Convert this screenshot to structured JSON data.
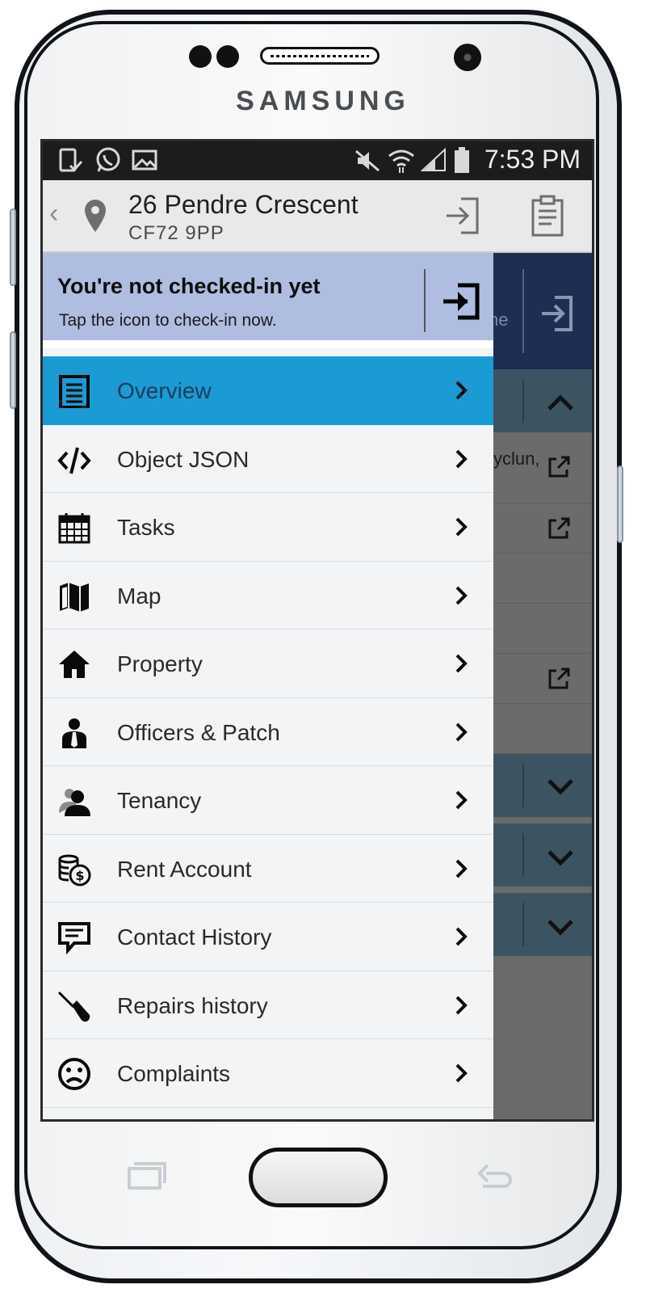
{
  "device": {
    "brand": "SAMSUNG"
  },
  "statusbar": {
    "time": "7:53 PM"
  },
  "appbar": {
    "title": "26 Pendre Crescent",
    "subtitle": "CF72 9PP"
  },
  "checkin_banner": {
    "title": "You're not checked-in yet",
    "subtitle": "Tap the icon to check-in now."
  },
  "background_snippets": {
    "navy_text": "ne",
    "row_text": "yclun,"
  },
  "menu": {
    "items": [
      {
        "label": "Overview",
        "icon": "document-icon",
        "active": true
      },
      {
        "label": "Object JSON",
        "icon": "code-icon"
      },
      {
        "label": "Tasks",
        "icon": "calendar-icon"
      },
      {
        "label": "Map",
        "icon": "map-icon"
      },
      {
        "label": "Property",
        "icon": "home-icon"
      },
      {
        "label": "Officers & Patch",
        "icon": "officer-icon"
      },
      {
        "label": "Tenancy",
        "icon": "tenants-icon"
      },
      {
        "label": "Rent Account",
        "icon": "coins-icon"
      },
      {
        "label": "Contact History",
        "icon": "chat-icon"
      },
      {
        "label": "Repairs history",
        "icon": "screwdriver-icon"
      },
      {
        "label": "Complaints",
        "icon": "sad-face-icon"
      }
    ]
  },
  "colors": {
    "active_item": "#1a9bd4",
    "banner": "#aebde0",
    "navy": "#1e2d52",
    "teal": "#3c5461"
  }
}
